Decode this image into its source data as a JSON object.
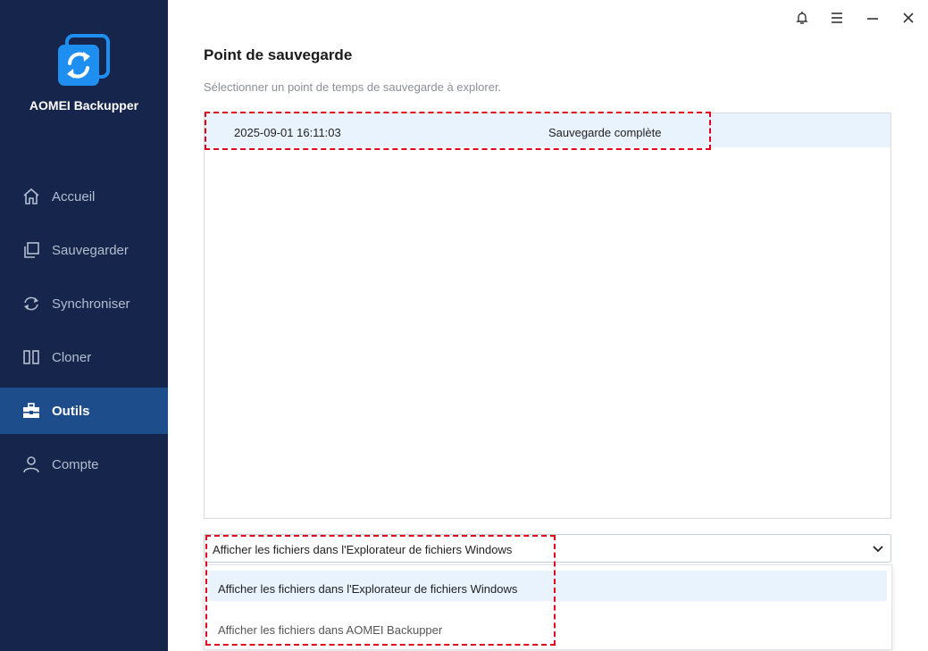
{
  "app": {
    "name": "AOMEI Backupper"
  },
  "sidebar": {
    "items": [
      {
        "label": "Accueil",
        "icon": "home-icon",
        "active": false
      },
      {
        "label": "Sauvegarder",
        "icon": "copy-icon",
        "active": false
      },
      {
        "label": "Synchroniser",
        "icon": "sync-icon",
        "active": false
      },
      {
        "label": "Cloner",
        "icon": "clone-icon",
        "active": false
      },
      {
        "label": "Outils",
        "icon": "toolbox-icon",
        "active": true
      },
      {
        "label": "Compte",
        "icon": "user-icon",
        "active": false
      }
    ]
  },
  "window_controls": [
    "bell-icon",
    "menu-icon",
    "minimize-icon",
    "close-icon"
  ],
  "main": {
    "title": "Point de sauvegarde",
    "subtitle": "Sélectionner un point de temps de sauvegarde à explorer.",
    "backup_points": [
      {
        "date": "2025-09-01 16:11:03",
        "type": "Sauvegarde complète"
      }
    ],
    "explore_select": {
      "value": "Afficher les fichiers dans l'Explorateur de fichiers Windows",
      "options": [
        "Afficher les fichiers dans l'Explorateur de fichiers Windows",
        "Afficher les fichiers dans AOMEI Backupper"
      ]
    }
  },
  "colors": {
    "sidebar_bg": "#15254b",
    "active_item_bg": "#1e4d8c",
    "selection_bg": "#e9f3fe",
    "highlight_dash": "#e0001b",
    "brand_blue": "#1f8ef1"
  }
}
